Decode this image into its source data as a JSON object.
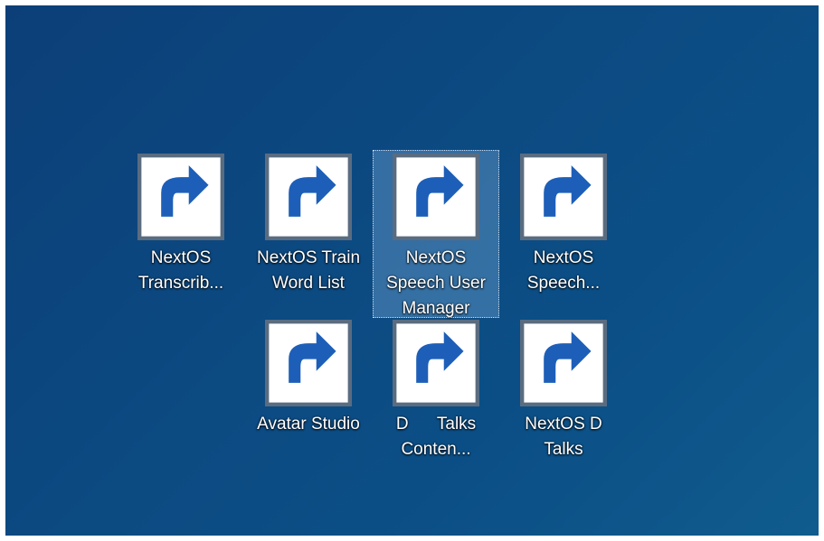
{
  "desktop": {
    "icons": [
      {
        "label": "NextOS\nTranscrib...",
        "icon": "transcribe-icon",
        "selected": false
      },
      {
        "label": "NextOS Train\nWord List",
        "icon": "train-word-list-icon",
        "selected": false
      },
      {
        "label": "NextOS\nSpeech User\nManager",
        "icon": "d-logo-ribbon-icon",
        "selected": true
      },
      {
        "label": "NextOS\nSpeech...",
        "icon": "target-dart-icon",
        "selected": false
      },
      {
        "label": "Avatar Studio",
        "icon": "d-logo-circle-icon",
        "selected": false
      },
      {
        "label": "D      Talks\nConten...",
        "icon": "d-logo-ribbon-icon",
        "selected": false
      },
      {
        "label": "NextOS D\nTalks",
        "icon": "avatar-photo-icon",
        "selected": false
      }
    ],
    "colors": {
      "background": "#0c4a82",
      "d_logo_red": "#c4192a",
      "shortcut_arrow": "#1d5fb8",
      "selection": "#78aad7"
    }
  }
}
